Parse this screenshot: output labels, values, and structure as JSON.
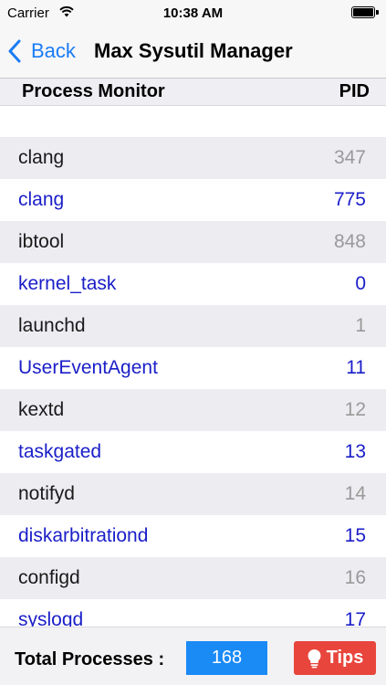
{
  "status_bar": {
    "carrier": "Carrier",
    "time": "10:38 AM",
    "wifi_icon": "wifi-icon",
    "battery_icon": "battery-icon"
  },
  "nav": {
    "back_label": "Back",
    "back_icon": "chevron-left-icon",
    "title": "Max Sysutil Manager"
  },
  "table_header": {
    "name": "Process Monitor",
    "pid": "PID"
  },
  "processes": [
    {
      "name": "clang",
      "pid": "347",
      "style": "a"
    },
    {
      "name": "clang",
      "pid": "775",
      "style": "b"
    },
    {
      "name": "ibtool",
      "pid": "848",
      "style": "a"
    },
    {
      "name": "kernel_task",
      "pid": "0",
      "style": "b"
    },
    {
      "name": "launchd",
      "pid": "1",
      "style": "a"
    },
    {
      "name": "UserEventAgent",
      "pid": "11",
      "style": "b"
    },
    {
      "name": "kextd",
      "pid": "12",
      "style": "a"
    },
    {
      "name": "taskgated",
      "pid": "13",
      "style": "b"
    },
    {
      "name": "notifyd",
      "pid": "14",
      "style": "a"
    },
    {
      "name": "diskarbitrationd",
      "pid": "15",
      "style": "b"
    },
    {
      "name": "configd",
      "pid": "16",
      "style": "a"
    },
    {
      "name": "syslogd",
      "pid": "17",
      "style": "b"
    }
  ],
  "footer": {
    "total_label": "Total Processes :",
    "total_value": "168",
    "tips_label": "Tips",
    "tips_icon": "lightbulb-icon"
  },
  "colors": {
    "accent_blue": "#1a7cf5",
    "process_blue": "#1a1ec8",
    "total_badge": "#1a8af5",
    "tips_red": "#e8453c"
  }
}
